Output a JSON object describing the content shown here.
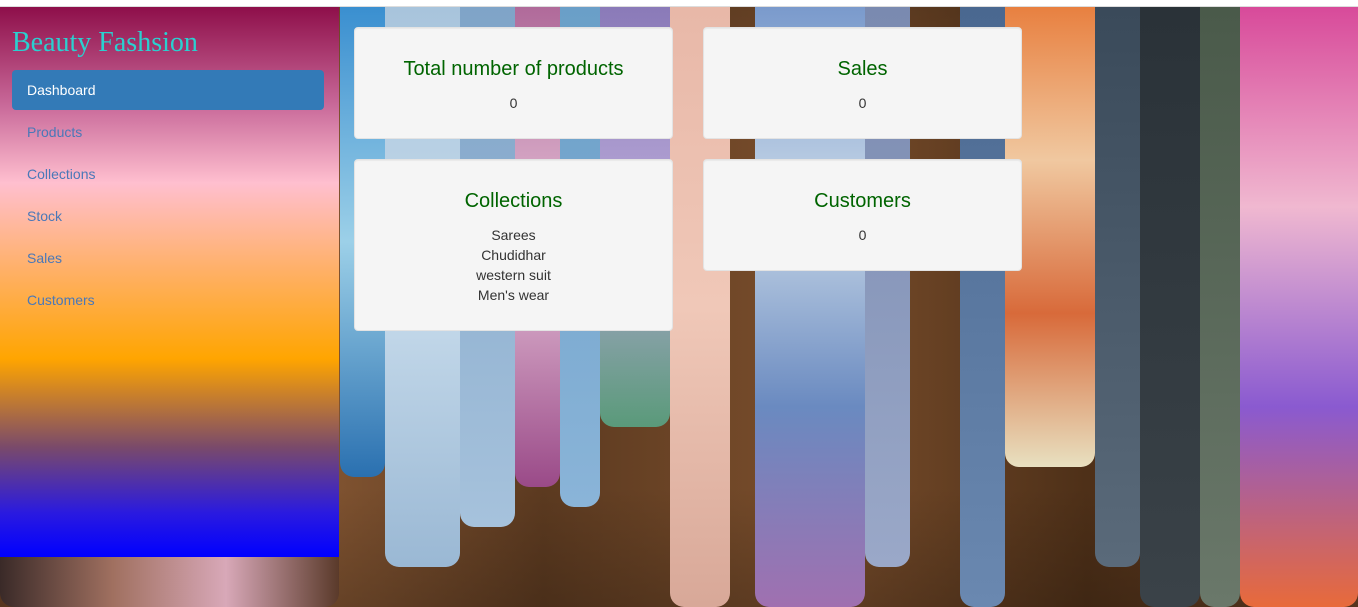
{
  "brand": "Beauty Fashsion",
  "nav": [
    {
      "label": "Dashboard",
      "active": true
    },
    {
      "label": "Products"
    },
    {
      "label": "Collections"
    },
    {
      "label": "Stock"
    },
    {
      "label": "Sales"
    },
    {
      "label": "Customers"
    }
  ],
  "cards": {
    "products": {
      "title": "Total number of products",
      "value": "0"
    },
    "sales": {
      "title": "Sales",
      "value": "0"
    },
    "collections": {
      "title": "Collections",
      "items": [
        "Sarees",
        "Chudidhar",
        "western suit",
        "Men's wear"
      ]
    },
    "customers": {
      "title": "Customers",
      "value": "0"
    }
  }
}
